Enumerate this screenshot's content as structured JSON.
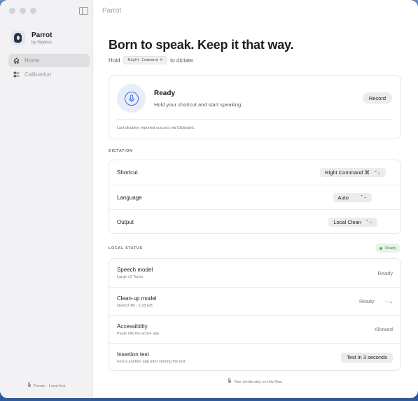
{
  "window": {
    "title": "Parrot"
  },
  "sidebar": {
    "app_name": "Parrot",
    "app_subtitle": "by Sayless",
    "items": [
      {
        "label": "Home",
        "icon": "house-icon",
        "active": true
      },
      {
        "label": "Calibration",
        "icon": "sliders-icon",
        "active": false
      }
    ],
    "footer": "Private · Local-first"
  },
  "hero": {
    "title": "Born to speak. Keep it that way.",
    "hold_prefix": "Hold",
    "shortcut_kbd": "Right Command ⌘",
    "hold_suffix": "to dictate."
  },
  "status_card": {
    "title": "Ready",
    "subtitle": "Hold your shortcut and start speaking.",
    "record_label": "Record",
    "note": "Last dictation reported success via Clipboard."
  },
  "dictation": {
    "section_label": "DICTATION",
    "rows": [
      {
        "label": "Shortcut",
        "value": "Right Command ⌘"
      },
      {
        "label": "Language",
        "value": "Auto"
      },
      {
        "label": "Output",
        "value": "Local Clean"
      }
    ]
  },
  "local_status": {
    "section_label": "LOCAL STATUS",
    "badge": "Ready",
    "badge_color": "#34c759",
    "rows": [
      {
        "label": "Speech model",
        "sub": "Large v3 Turbo",
        "value": "Ready"
      },
      {
        "label": "Clean-up model",
        "sub": "Qwen3 4B · 2.28 GB",
        "value": "Ready",
        "more": "···"
      },
      {
        "label": "Accessibility",
        "sub": "Paste into the active app",
        "value": "Allowed"
      },
      {
        "label": "Insertion test",
        "sub": "Focus another app after starting the test",
        "button": "Test in 3 seconds"
      }
    ]
  },
  "footer": {
    "note": "Your words stay on this Mac."
  },
  "colors": {
    "accent": "#3e6ccf",
    "sidebar_bg": "#f2f2f4"
  }
}
